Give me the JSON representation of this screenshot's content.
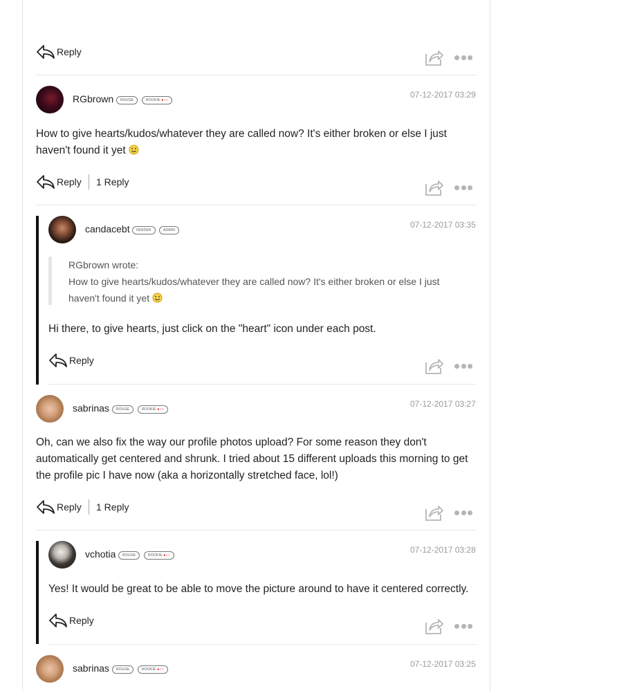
{
  "actions": {
    "reply_label": "Reply"
  },
  "top_post": {},
  "posts": [
    {
      "username": "RGbrown",
      "badges": [
        "ROUGE",
        "ROOKIE"
      ],
      "date": "07-12-2017 03:29",
      "text": "How to give hearts/kudos/whatever they are called now? It's either broken or else I just haven't found it yet",
      "reply_count": "1 Reply"
    },
    {
      "username": "candacebt",
      "badges": [
        "INSIDER",
        "ADMIN"
      ],
      "date": "07-12-2017 03:35",
      "quote_author": "RGbrown wrote:",
      "quote_text": "How to give hearts/kudos/whatever they are called now? It's either broken or else I just haven't found it yet",
      "text": "Hi there, to give hearts, just click on the \"heart\" icon under each post."
    },
    {
      "username": "sabrinas",
      "badges": [
        "ROUGE",
        "ROOKIE"
      ],
      "date": "07-12-2017 03:27",
      "text": "Oh, can we also fix the way our profile photos upload? For some reason they don't automatically get centered and shrunk. I tried about 15 different uploads this morning to get the profile pic I have now (aka a horizontally stretched face, lol!)",
      "reply_count": "1 Reply"
    },
    {
      "username": "vchotia",
      "badges": [
        "ROUGE",
        "ROOKIE"
      ],
      "date": "07-12-2017 03:28",
      "text": "Yes! It would be great to be able to move the picture around to have it centered correctly."
    },
    {
      "username": "sabrinas",
      "badges": [
        "ROUGE",
        "ROOKIE"
      ],
      "date": "07-12-2017 03:25"
    }
  ],
  "icons": {
    "reply": "reply-arrow-icon",
    "share": "share-icon",
    "more": "more-options-icon",
    "smiley": "smiley-emoji-icon"
  },
  "colors": {
    "thread_bar": "#111111",
    "date_text": "#9a9a9a",
    "icon_gray": "#b5b5b5"
  }
}
